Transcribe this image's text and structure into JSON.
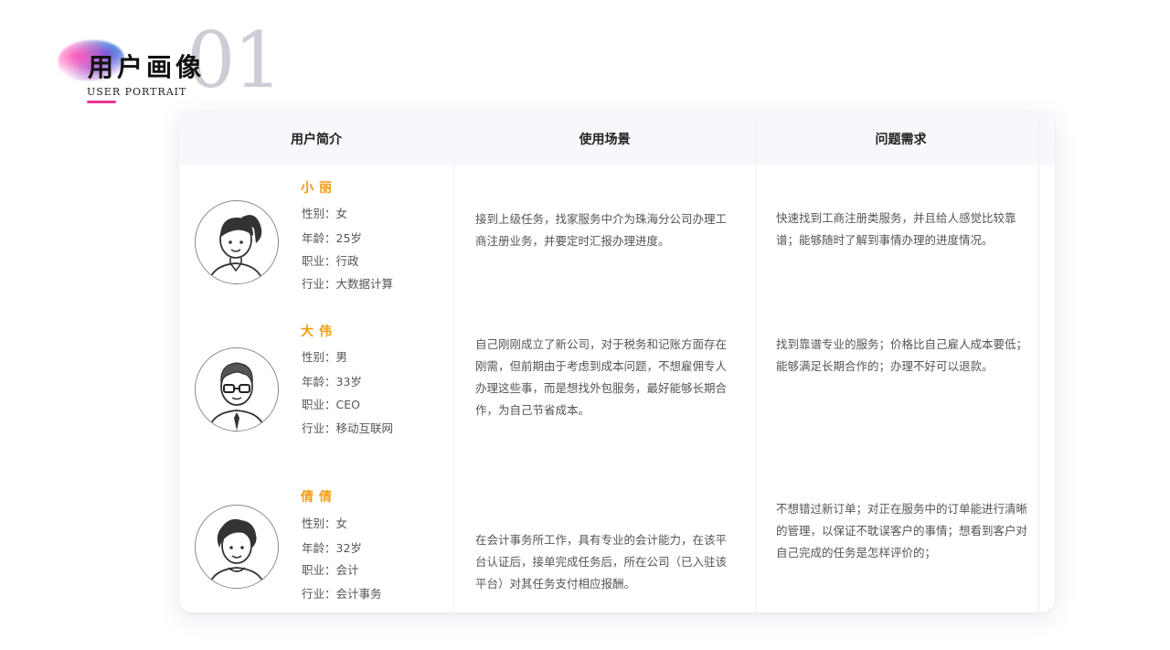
{
  "brand": {
    "number": "01",
    "title": "用户画像",
    "subtitle": "USER PORTRAIT"
  },
  "table": {
    "headers": [
      "用户简介",
      "使用场景",
      "问题需求"
    ]
  },
  "users": [
    {
      "name": "小丽",
      "gender": "性别：女",
      "age": "年龄：25岁",
      "job": "职业：行政",
      "industry": "行业：大数据计算",
      "scenario": "接到上级任务，找家服务中介为珠海分公司办理工商注册业务，并要定时汇报办理进度。",
      "needs": "快速找到工商注册类服务，并且给人感觉比较靠谱；能够随时了解到事情办理的进度情况。"
    },
    {
      "name": "大伟",
      "gender": "性别：男",
      "age": "年龄：33岁",
      "job": "职业：CEO",
      "industry": "行业：移动互联网",
      "scenario": "自己刚刚成立了新公司，对于税务和记账方面存在刚需，但前期由于考虑到成本问题，不想雇佣专人办理这些事，而是想找外包服务，最好能够长期合作，为自己节省成本。",
      "needs": "找到靠谱专业的服务；价格比自己雇人成本要低；能够满足长期合作的；办理不好可以退款。"
    },
    {
      "name": "倩倩",
      "gender": "性别：女",
      "age": "年龄：32岁",
      "job": "职业：会计",
      "industry": "行业：会计事务",
      "scenario": "在会计事务所工作，具有专业的会计能力，在该平台认证后，接单完成任务后，所在公司（已入驻该平台）对其任务支付相应报酬。",
      "needs": "不想错过新订单；对正在服务中的订单能进行清晰的管理，以保证不耽误客户的事情；想看到客户对自己完成的任务是怎样评价的；"
    }
  ],
  "colors": {
    "name": "#f39c12",
    "accent_underline": "#e8358f"
  }
}
